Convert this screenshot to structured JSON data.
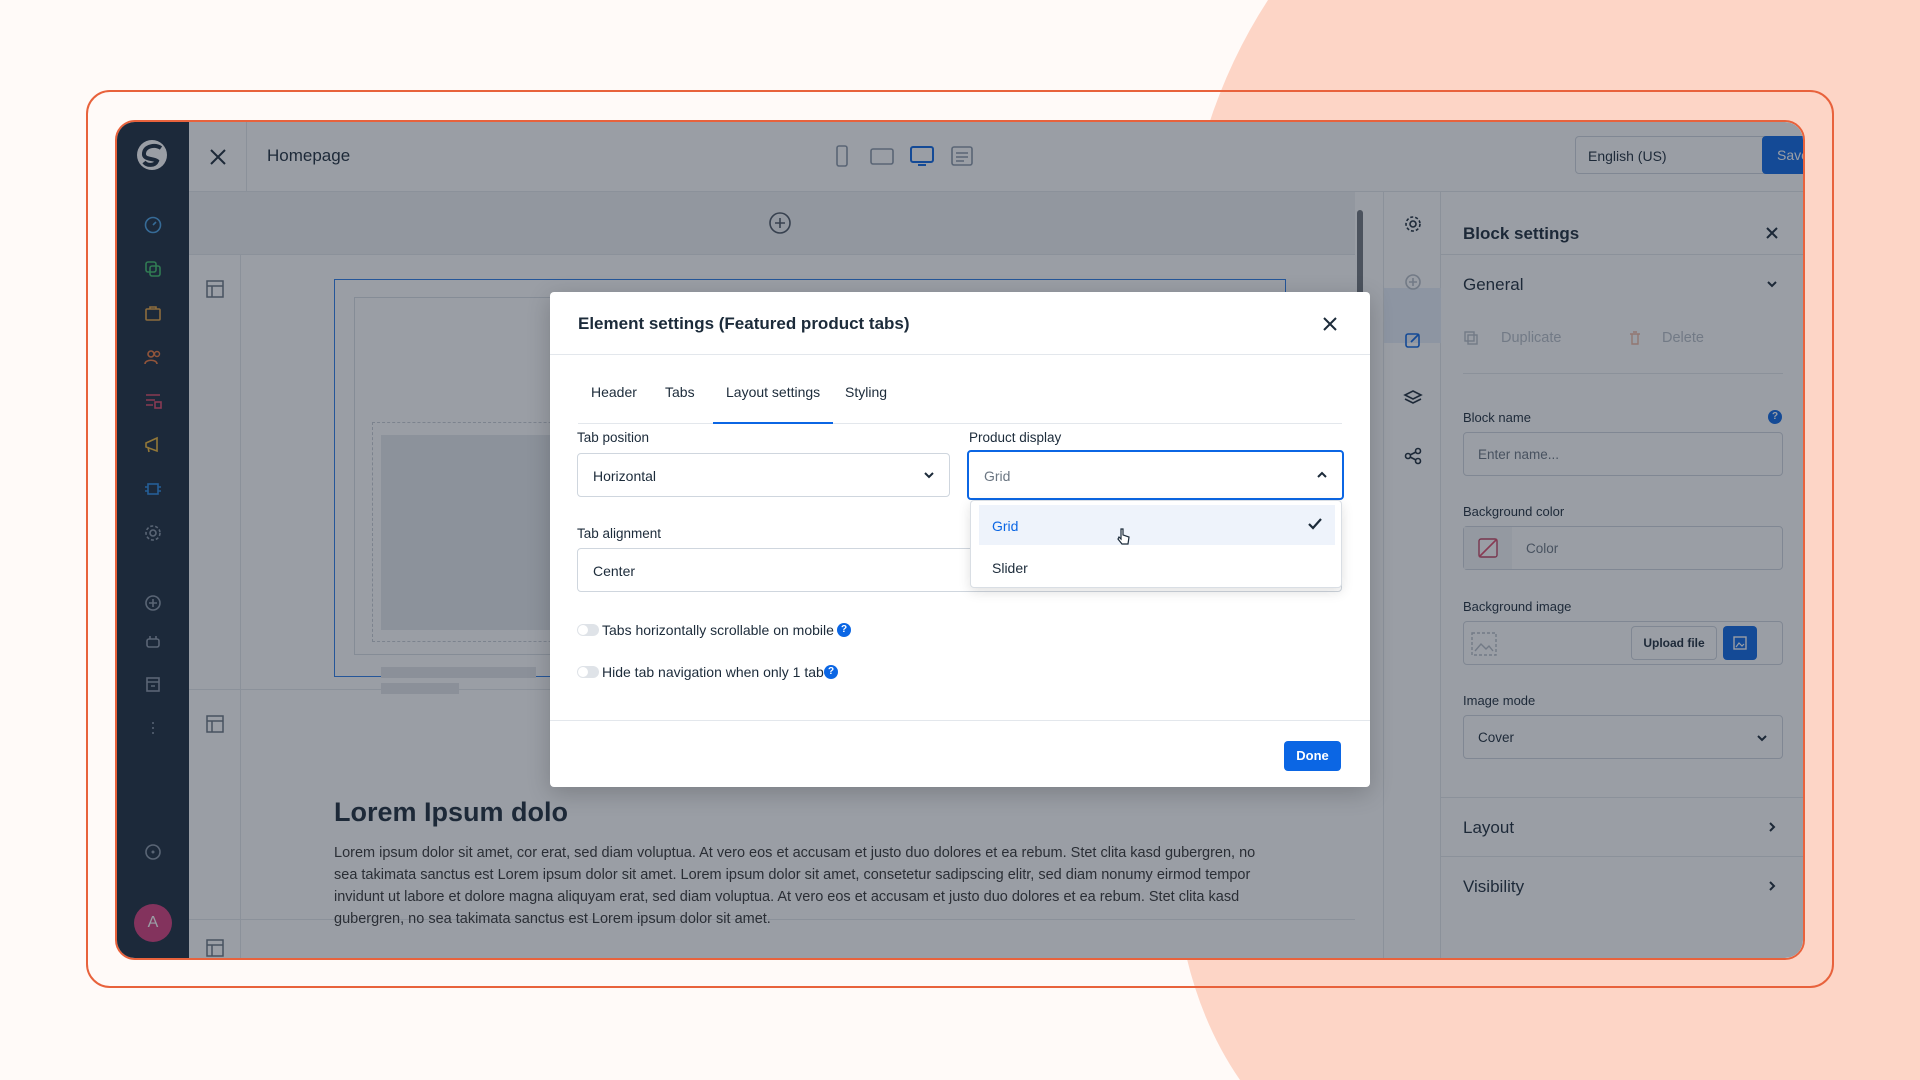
{
  "colors": {
    "accent": "#0b66e4",
    "frame": "#e8623c",
    "nav_bg": "#1a2a3d",
    "avatar": "#d63d7c"
  },
  "topbar": {
    "page_title": "Homepage",
    "language": "English (US)",
    "save_label": "Save",
    "devices": [
      "mobile-icon",
      "tablet-icon",
      "desktop-icon",
      "list-icon"
    ]
  },
  "nav": {
    "items": [
      "dashboard-icon",
      "catalogues-icon",
      "orders-icon",
      "customers-icon",
      "content-icon",
      "marketing-icon",
      "extensions-icon",
      "settings-icon",
      "add-sales-channel-icon",
      "headless-icon",
      "storefront-icon",
      "more-icon"
    ],
    "help": "help-icon",
    "avatar_letter": "A"
  },
  "canvas": {
    "heading": "Lorem Ipsum dolo",
    "paragraph": "Lorem ipsum dolor sit amet, cor                                                                                              erat, sed diam voluptua. At vero eos et accusam et justo duo dolores et ea rebum. Stet clita kasd gubergren, no sea takimata sanctus est Lorem ipsum dolor sit amet. Lorem ipsum dolor sit amet, consetetur sadipscing elitr, sed diam nonumy eirmod tempor invidunt ut labore et dolore magna aliquyam erat, sed diam voluptua. At vero eos et accusam et justo duo dolores et ea rebum. Stet clita kasd gubergren, no sea takimata sanctus est Lorem ipsum dolor sit amet."
  },
  "panel": {
    "title": "Block settings",
    "general": "General",
    "duplicate": "Duplicate",
    "delete": "Delete",
    "block_name_label": "Block name",
    "block_name_placeholder": "Enter name...",
    "bg_color_label": "Background color",
    "bg_color_placeholder": "Color",
    "bg_image_label": "Background image",
    "upload_label": "Upload file",
    "image_mode_label": "Image mode",
    "image_mode_value": "Cover",
    "layout": "Layout",
    "visibility": "Visibility"
  },
  "modal": {
    "title": "Element settings (Featured product tabs)",
    "tabs": [
      "Header",
      "Tabs",
      "Layout settings",
      "Styling"
    ],
    "active_tab": "Layout settings",
    "tab_position_label": "Tab position",
    "tab_position_value": "Horizontal",
    "product_display_label": "Product display",
    "product_display_value": "Grid",
    "product_display_options": [
      "Grid",
      "Slider"
    ],
    "tab_alignment_label": "Tab alignment",
    "tab_alignment_value": "Center",
    "toggle1_label": "Tabs horizontally scrollable on mobile",
    "toggle2_label": "Hide tab navigation when only 1 tab",
    "done_label": "Done"
  }
}
